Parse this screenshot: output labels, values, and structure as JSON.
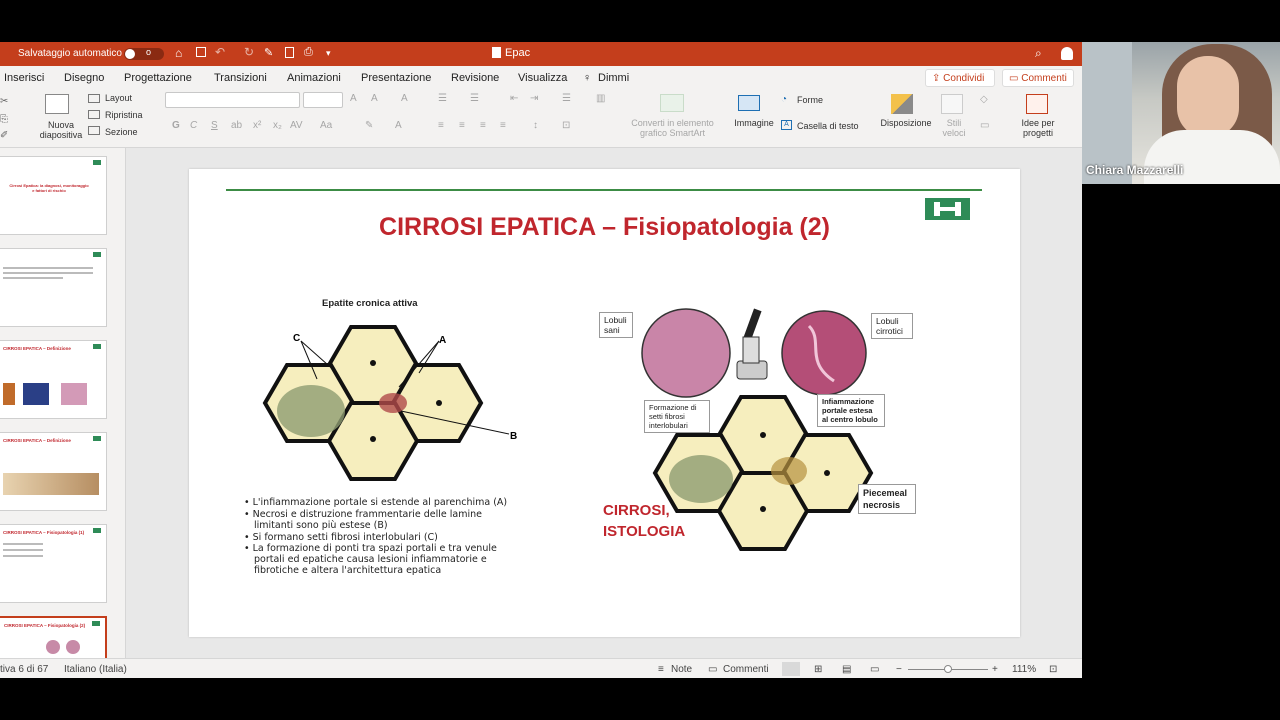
{
  "titlebar": {
    "autosave_label": "Salvataggio automatico",
    "autosave_state": "o",
    "doc_title": "Epac",
    "colors": {
      "accent": "#c43e1c"
    }
  },
  "tabs": [
    "Inserisci",
    "Disegno",
    "Progettazione",
    "Transizioni",
    "Animazioni",
    "Presentazione",
    "Revisione",
    "Visualizza",
    "Dimmi"
  ],
  "share_button": "Condividi",
  "comments_button": "Commenti",
  "ribbon": {
    "new_slide": "Nuova diapositiva",
    "layout": "Layout",
    "reset": "Ripristina",
    "section": "Sezione",
    "smartart": "Converti in elemento grafico SmartArt",
    "image": "Immagine",
    "shapes": "Forme",
    "textbox": "Casella di testo",
    "arrange": "Disposizione",
    "styles": "Stili veloci",
    "designer": "Idee per progetti"
  },
  "thumbnails": [
    {
      "title": "Cirrosi Epatica: la diagnosi, monitoraggio e fattori di rischio"
    },
    {
      "title": ""
    },
    {
      "title": "CIRROSI EPATICA – Definizione"
    },
    {
      "title": "CIRROSI EPATICA – Definizione"
    },
    {
      "title": "CIRROSI EPATICA – Fisiopatologia (1)"
    },
    {
      "title": "CIRROSI EPATICA – Fisiopatologia (2)"
    }
  ],
  "slide": {
    "title": "CIRROSI EPATICA – Fisiopatologia  (2)",
    "left_diagram_title": "Epatite cronica attiva",
    "labels": {
      "a": "A",
      "b": "B",
      "c": "C"
    },
    "bullets": [
      "L'infiammazione portale si estende al parenchima (A)",
      "Necrosi e distruzione frammentarie delle lamine limitanti sono più estese (B)",
      "Si formano setti fibrosi interlobulari (C)",
      "La formazione di ponti tra spazi portali e tra venule portali ed epatiche causa lesioni infiammatorie e fibrotiche e altera l'architettura epatica"
    ],
    "callouts": {
      "lobuli_sani": "Lobuli sani",
      "lobuli_cirrotici": "Lobuli cirrotici",
      "setti": "Formazione di setti fibrosi interlobulari",
      "infiammazione": "Infiammazione portale estesa al centro lobulo",
      "piecemeal": "Piecemeal necrosis"
    },
    "cirrosi_label": "CIRROSI, ISTOLOGIA"
  },
  "status": {
    "slide_counter": "tiva 6 di 67",
    "language": "Italiano (Italia)",
    "notes": "Note",
    "comments": "Commenti",
    "zoom": "111%"
  },
  "video": {
    "participant": "Chiara Mazzarelli"
  }
}
